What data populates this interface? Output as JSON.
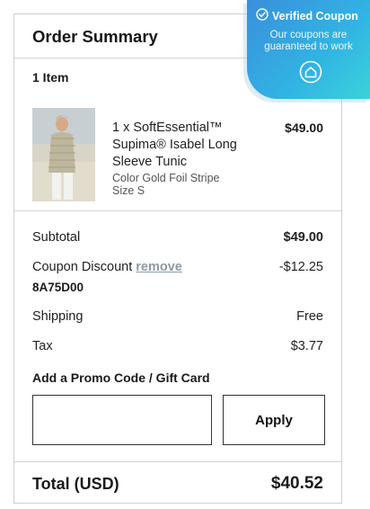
{
  "summary": {
    "title": "Order Summary",
    "item_count": "1 Item"
  },
  "item": {
    "name": "1 x SoftEssential™ Supima® Isabel Long Sleeve Tunic",
    "color": "Color Gold Foil Stripe",
    "size": "Size S",
    "price": "$49.00"
  },
  "totals": {
    "subtotal_label": "Subtotal",
    "subtotal_value": "$49.00",
    "coupon_label": "Coupon Discount",
    "coupon_remove": "remove",
    "coupon_value": "-$12.25",
    "coupon_code": "8A75D00",
    "shipping_label": "Shipping",
    "shipping_value": "Free",
    "tax_label": "Tax",
    "tax_value": "$3.77",
    "total_label": "Total (USD)",
    "total_value": "$40.52"
  },
  "promo": {
    "label": "Add a Promo Code / Gift Card",
    "placeholder": "",
    "value": "",
    "apply_label": "Apply"
  },
  "badge": {
    "title": "Verified Coupon",
    "subtitle_line1": "Our coupons are",
    "subtitle_line2": "guaranteed to work",
    "check_icon": "check-circle-icon",
    "logo_icon": "house-circle-icon"
  },
  "colors": {
    "badge_gradient_start": "#3a8fdc",
    "badge_gradient_end": "#3ad3d9",
    "remove_link": "#8b9aa6"
  }
}
